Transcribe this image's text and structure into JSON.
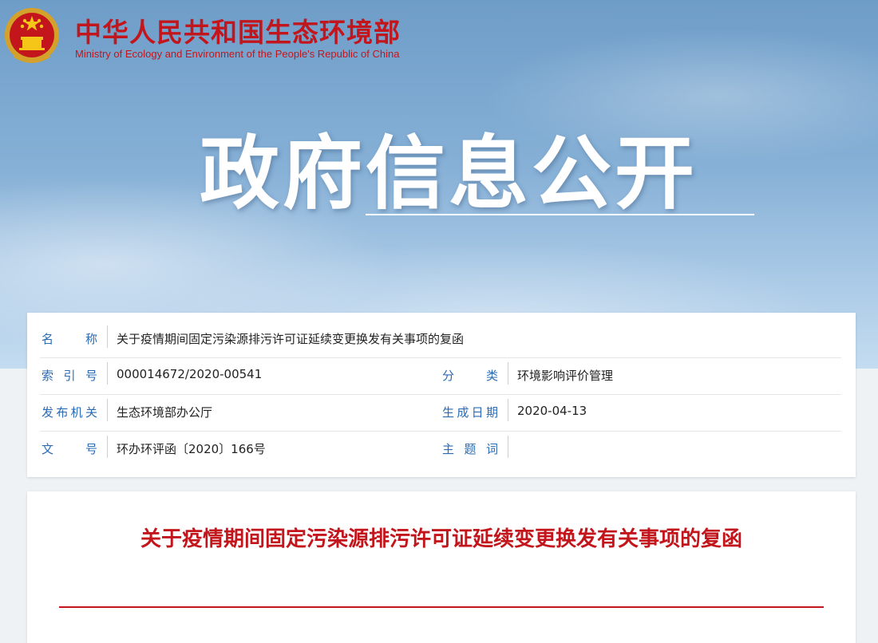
{
  "header": {
    "org_name_cn": "中华人民共和国生态环境部",
    "org_name_en": "Ministry of Ecology and Environment of the People's Republic of China",
    "banner_title": "政府信息公开",
    "emblem_icon": "national-emblem-icon"
  },
  "meta": {
    "name_label": "名　称",
    "name_value": "关于疫情期间固定污染源排污许可证延续变更换发有关事项的复函",
    "index_label": "索引号",
    "index_value": "000014672/2020-00541",
    "category_label": "分　类",
    "category_value": "环境影响评价管理",
    "issuer_label": "发布机关",
    "issuer_value": "生态环境部办公厅",
    "date_label": "生成日期",
    "date_value": "2020-04-13",
    "doc_no_label": "文　号",
    "doc_no_value": "环办环评函〔2020〕166号",
    "keywords_label": "主题词",
    "keywords_value": ""
  },
  "document": {
    "title": "关于疫情期间固定污染源排污许可证延续变更换发有关事项的复函"
  },
  "colors": {
    "brand_red": "#c3161c",
    "label_blue": "#2a6bb4",
    "banner_blue": "#86b0d6"
  }
}
